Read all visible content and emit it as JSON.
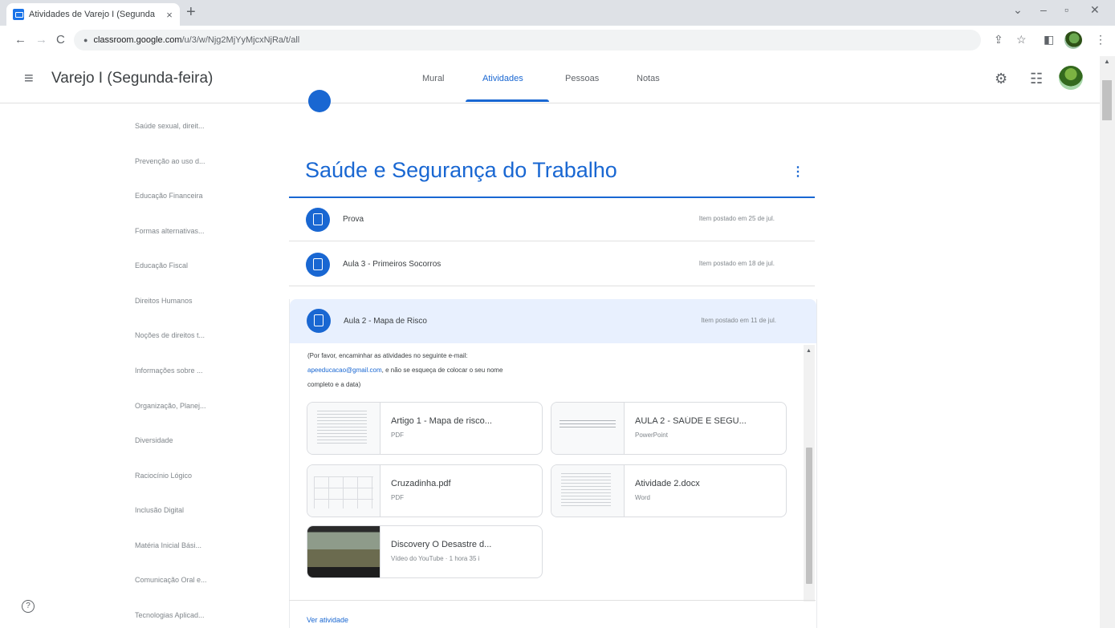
{
  "browser": {
    "tab_title": "Atividades de Varejo I (Segunda",
    "tab_close": "×",
    "new_tab": "+",
    "window_controls": {
      "menu": "⌄",
      "minimize": "–",
      "maximize": "▫",
      "close": "✕"
    },
    "nav": {
      "back": "←",
      "forward": "→",
      "reload": "C"
    },
    "url_host": "classroom.google.com",
    "url_path": "/u/3/w/Njg2MjYyMjcxNjRa/t/all"
  },
  "header": {
    "menu_icon": "≡",
    "class_title": "Varejo I (Segunda-feira)",
    "tabs": [
      {
        "label": "Mural",
        "active": false
      },
      {
        "label": "Atividades",
        "active": true
      },
      {
        "label": "Pessoas",
        "active": false
      },
      {
        "label": "Notas",
        "active": false
      }
    ],
    "settings_icon": "⚙",
    "apps_icon": "☷"
  },
  "topics": [
    "Saúde sexual, direit...",
    "Prevenção ao uso d...",
    "Educação Financeira",
    "Formas alternativas...",
    "Educação Fiscal",
    "Direitos Humanos",
    "Noções de direitos t...",
    "Informações sobre ...",
    "Organização, Planej...",
    "Diversidade",
    "Raciocínio Lógico",
    "Inclusão Digital",
    "Matéria Inicial Bási...",
    "Comunicação Oral e...",
    "Tecnologias Aplicad..."
  ],
  "help_icon": "?",
  "section": {
    "title": "Saúde e Segurança do Trabalho",
    "more_icon": "⋮"
  },
  "items": [
    {
      "title": "Prova",
      "date": "Item postado em 25 de jul."
    },
    {
      "title": "Aula 3 - Primeiros Socorros",
      "date": "Item postado em 18 de jul."
    },
    {
      "title": "Aula 2 - Mapa de Risco",
      "date": "Item postado em 11 de jul."
    }
  ],
  "description": {
    "line1": "(Por favor, encaminhar as atividades no seguinte e-mail:",
    "email": "apeeducacao@gmail.com",
    "line2_rest": ", e não se esqueça de colocar o seu nome",
    "line3": "completo e a data)"
  },
  "attachments": [
    {
      "name": "Artigo 1 - Mapa de risco...",
      "type": "PDF"
    },
    {
      "name": "AULA 2 - SAÚDE E SEGU...",
      "type": "PowerPoint"
    },
    {
      "name": "Cruzadinha.pdf",
      "type": "PDF"
    },
    {
      "name": "Atividade 2.docx",
      "type": "Word"
    },
    {
      "name": "Discovery O Desastre d...",
      "type": "Vídeo do YouTube · 1 hora 35 i"
    }
  ],
  "view_activity": "Ver atividade",
  "colors": {
    "accent": "#1967d2",
    "highlight": "#e8f0fe"
  }
}
